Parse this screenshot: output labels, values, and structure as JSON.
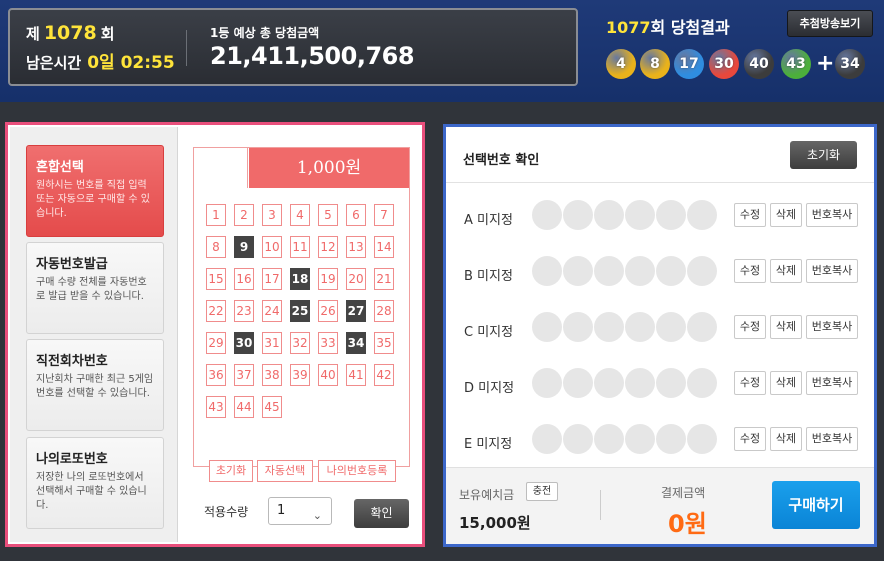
{
  "header": {
    "round_prefix": "제",
    "round_number": "1078",
    "round_suffix": "회",
    "remaining_label": "남은시간",
    "remaining_time": "0일 02:55",
    "prize_label": "1등 예상 총 당첨금액",
    "prize_value": "21,411,500,768"
  },
  "result": {
    "round": "1077",
    "title_suffix": "회 당첨결과",
    "broadcast_label": "추첨방송보기",
    "plus": "+",
    "balls": [
      {
        "num": "4",
        "color": "#e9b21b"
      },
      {
        "num": "8",
        "color": "#e9b21b"
      },
      {
        "num": "17",
        "color": "#2f8de0"
      },
      {
        "num": "30",
        "color": "#e8483c"
      },
      {
        "num": "40",
        "color": "#3c3c3c"
      },
      {
        "num": "43",
        "color": "#4caf3b"
      }
    ],
    "bonus": {
      "num": "34",
      "color": "#3c3c3c"
    }
  },
  "menu": [
    {
      "title": "혼합선택",
      "desc": "원하시는 번호를 직접 입력 또는 자동으로 구매할 수 있습니다.",
      "active": true
    },
    {
      "title": "자동번호발급",
      "desc": "구매 수량 전체를 자동번호로 발급 받을 수 있습니다.",
      "active": false
    },
    {
      "title": "직전회차번호",
      "desc": "지난회차 구매한 최근 5게임 번호를 선택할 수 있습니다.",
      "active": false
    },
    {
      "title": "나의로또번호",
      "desc": "저장한 나의 로또번호에서 선택해서 구매할 수 있습니다.",
      "active": false
    }
  ],
  "board": {
    "price": "1,000원",
    "selected": [
      9,
      18,
      25,
      27,
      30,
      34
    ],
    "total_numbers": 45,
    "buttons": [
      "초기화",
      "자동선택",
      "나의번호등록"
    ],
    "qty_label": "적용수량",
    "qty_value": "1",
    "confirm_label": "확인"
  },
  "selection": {
    "title": "선택번호 확인",
    "reset_label": "초기화",
    "rows": [
      {
        "label": "A 미지정"
      },
      {
        "label": "B 미지정"
      },
      {
        "label": "C 미지정"
      },
      {
        "label": "D 미지정"
      },
      {
        "label": "E 미지정"
      }
    ],
    "edit_label": "수정",
    "delete_label": "삭제",
    "copy_label": "번호복사"
  },
  "footer": {
    "balance_label": "보유예치금",
    "charge_label": "충전",
    "balance_value": "15,000원",
    "pay_label": "결제금액",
    "pay_value": "0원",
    "buy_label": "구매하기"
  }
}
